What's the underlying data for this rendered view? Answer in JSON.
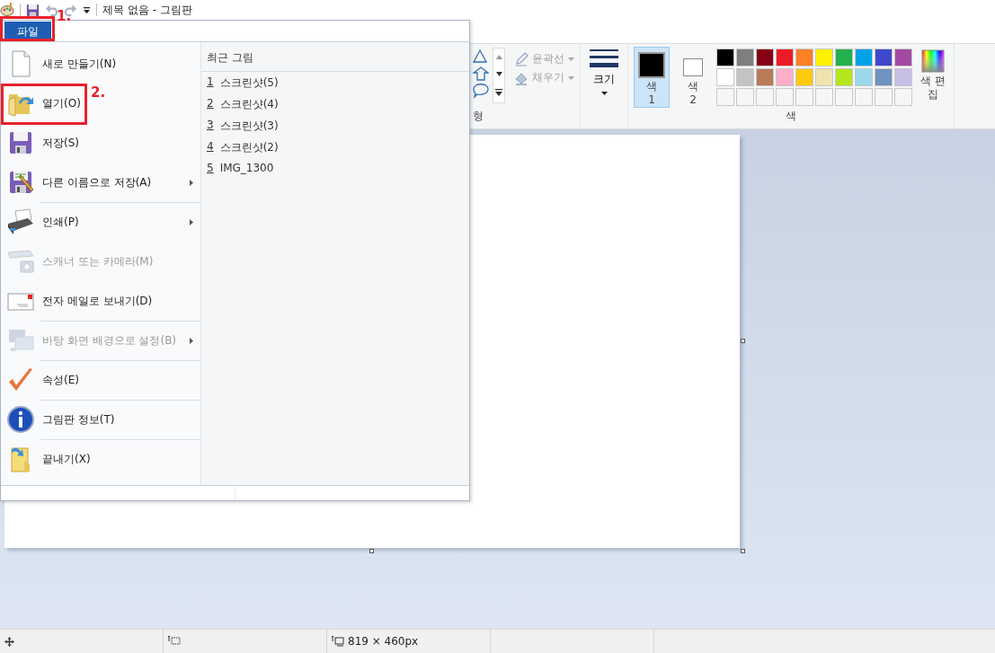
{
  "title_bar": {
    "title": "제목 없음 - 그림판"
  },
  "file_tab": {
    "label": "파일",
    "selected": true,
    "annotation": "1."
  },
  "file_menu": {
    "items": [
      {
        "label": "새로 만들기(N)",
        "disabled": false,
        "submenu": false,
        "separator_before": false
      },
      {
        "label": "열기(O)",
        "disabled": false,
        "submenu": false,
        "separator_before": false,
        "annotation": "2."
      },
      {
        "label": "저장(S)",
        "disabled": false,
        "submenu": false,
        "separator_before": false
      },
      {
        "label": "다른 이름으로 저장(A)",
        "disabled": false,
        "submenu": true,
        "separator_before": false
      },
      {
        "label": "인쇄(P)",
        "disabled": false,
        "submenu": true,
        "separator_before": true
      },
      {
        "label": "스캐너 또는 카메라(M)",
        "disabled": true,
        "submenu": false,
        "separator_before": false
      },
      {
        "label": "전자 메일로 보내기(D)",
        "disabled": false,
        "submenu": false,
        "separator_before": false
      },
      {
        "label": "바탕 화면 배경으로 설정(B)",
        "disabled": true,
        "submenu": true,
        "separator_before": true
      },
      {
        "label": "속성(E)",
        "disabled": false,
        "submenu": false,
        "separator_before": true
      },
      {
        "label": "그림판 정보(T)",
        "disabled": false,
        "submenu": false,
        "separator_before": true
      },
      {
        "label": "끝내기(X)",
        "disabled": false,
        "submenu": false,
        "separator_before": true
      }
    ],
    "recent": {
      "heading": "최근 그림",
      "files": [
        {
          "number": "1",
          "name": "스크린샷(5)"
        },
        {
          "number": "2",
          "name": "스크린샷(4)"
        },
        {
          "number": "3",
          "name": "스크린샷(3)"
        },
        {
          "number": "4",
          "name": "스크린샷(2)"
        },
        {
          "number": "5",
          "name": "IMG_1300"
        }
      ]
    }
  },
  "ribbon": {
    "shapes_group_label": "형",
    "outline": {
      "label": "윤곽선",
      "disabled": true
    },
    "fill": {
      "label": "채우기",
      "disabled": true
    },
    "size": {
      "label": "크기"
    },
    "color_slots": [
      {
        "label": "색",
        "number": "1",
        "color": "#000000",
        "selected": true
      },
      {
        "label": "색",
        "number": "2",
        "color": "#ffffff",
        "selected": false
      }
    ],
    "palette": [
      {
        "color": "#000000"
      },
      {
        "color": "#7f7f7f"
      },
      {
        "color": "#880015"
      },
      {
        "color": "#ed1c24"
      },
      {
        "color": "#ff7f27"
      },
      {
        "color": "#fff200"
      },
      {
        "color": "#22b14c"
      },
      {
        "color": "#00a2e8"
      },
      {
        "color": "#3f48cc"
      },
      {
        "color": "#a349a4"
      },
      {
        "color": "#ffffff"
      },
      {
        "color": "#c3c3c3"
      },
      {
        "color": "#b97a57"
      },
      {
        "color": "#ffaec9"
      },
      {
        "color": "#ffc90e"
      },
      {
        "color": "#efe4b0"
      },
      {
        "color": "#b5e61d"
      },
      {
        "color": "#99d9ea"
      },
      {
        "color": "#7092be"
      },
      {
        "color": "#c8bfe7"
      }
    ],
    "edit_colors": {
      "label": "색 편집"
    },
    "colors_group_label": "색"
  },
  "status_bar": {
    "canvas_size": "819 × 460px"
  }
}
